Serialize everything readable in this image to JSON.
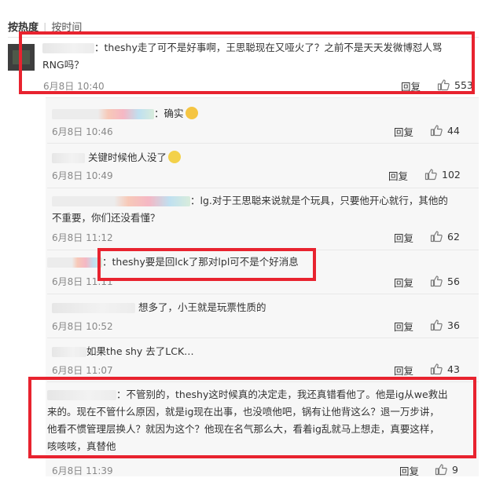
{
  "sort": {
    "hot": "按热度",
    "time": "按时间"
  },
  "main_comment": {
    "text_line1": "：theshy走了可不是好事啊，王思聪现在又哑火了？之前不是天天发微博怼人骂",
    "text_line2": "RNG吗？",
    "time": "6月8日 10:40",
    "reply": "回复",
    "likes": "553"
  },
  "replies": [
    {
      "text": "：确实",
      "time": "6月8日 10:46",
      "reply": "回复",
      "likes": "44",
      "emoji": "cat-face-icon"
    },
    {
      "text": "关键时候他人没了",
      "time": "6月8日 10:49",
      "reply": "回复",
      "likes": "102",
      "emoji": "grin-face-icon"
    },
    {
      "text_line1": "：lg.对于王思聪来说就是个玩具，只要他开心就行，其他的",
      "text_line2": "不重要，你们还没看懂？",
      "time": "6月8日 11:12",
      "reply": "回复",
      "likes": "62"
    },
    {
      "text": "：theshy要是回lck了那对lpl可不是个好消息",
      "time": "6月8日 11:11",
      "reply": "回复",
      "likes": "56"
    },
    {
      "text": "想多了，小王就是玩票性质的",
      "time": "6月8日 10:52",
      "reply": "回复",
      "likes": "36"
    },
    {
      "text": "如果the shy 去了LCK…",
      "time": "6月8日 11:07",
      "reply": "回复",
      "likes": "43"
    },
    {
      "text_line1": "：不管别的，theshy这时候真的决定走，我还真错看他了。他是ig从we救出",
      "text_line2": "来的。现在不管什么原因，就是ig现在出事，也没喷他吧，锅有让他背这么？退一万步讲，",
      "text_line3": "他看不惯管理层换人？就因为这个？他现在名气那么大，看着ig乱就马上想走，真要这样，",
      "text_line4": "咳咳咳，真替他",
      "time": "6月8日 11:39",
      "reply": "回复",
      "likes": "9"
    }
  ],
  "colors": {
    "highlight_border": "#e8232f",
    "time": "#888888",
    "text": "#333333"
  }
}
